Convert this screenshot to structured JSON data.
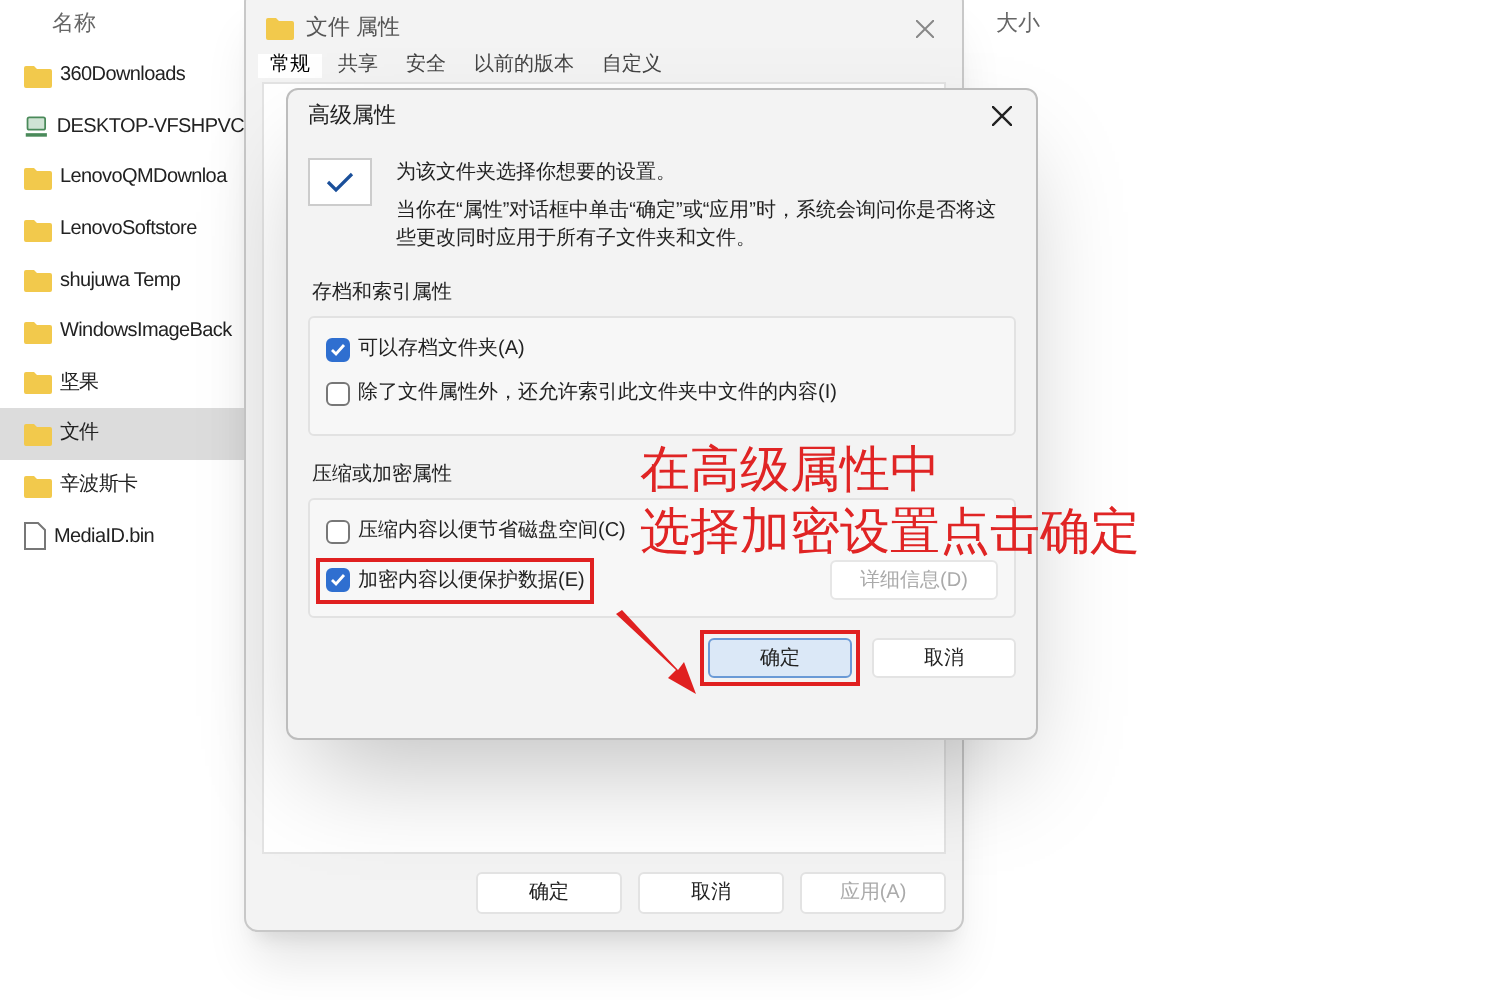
{
  "explorer": {
    "columns": [
      {
        "label": "名称"
      },
      {
        "label": "大小"
      }
    ],
    "items": [
      {
        "name": "360Downloads",
        "kind": "folder",
        "selected": false
      },
      {
        "name": "DESKTOP-VFSHPVC",
        "kind": "computer",
        "selected": false
      },
      {
        "name": "LenovoQMDownloa",
        "kind": "folder",
        "selected": false
      },
      {
        "name": "LenovoSoftstore",
        "kind": "folder",
        "selected": false
      },
      {
        "name": "shujuwa Temp",
        "kind": "folder",
        "selected": false
      },
      {
        "name": "WindowsImageBack",
        "kind": "folder",
        "selected": false
      },
      {
        "name": "坚果",
        "kind": "folder",
        "selected": false
      },
      {
        "name": "文件",
        "kind": "folder",
        "selected": true
      },
      {
        "name": "辛波斯卡",
        "kind": "folder",
        "selected": false
      },
      {
        "name": "MediaID.bin",
        "kind": "file",
        "selected": false
      }
    ]
  },
  "properties_window": {
    "title": "文件 属性",
    "tabs": [
      {
        "label": "常规",
        "selected": true
      },
      {
        "label": "共享",
        "selected": false
      },
      {
        "label": "安全",
        "selected": false
      },
      {
        "label": "以前的版本",
        "selected": false
      },
      {
        "label": "自定义",
        "selected": false
      }
    ],
    "buttons": [
      {
        "label": "确定",
        "disabled": false
      },
      {
        "label": "取消",
        "disabled": false
      },
      {
        "label": "应用(A)",
        "disabled": true
      }
    ]
  },
  "advanced_dialog": {
    "title": "高级属性",
    "intro": "为该文件夹选择你想要的设置。",
    "description": "当你在“属性”对话框中单击“确定”或“应用”时，系统会询问你是否将这些更改同时应用于所有子文件夹和文件。",
    "groups": [
      {
        "title": "存档和索引属性",
        "options": [
          {
            "label": "可以存档文件夹(A)",
            "checked": true,
            "annotated": false
          },
          {
            "label": "除了文件属性外，还允许索引此文件夹中文件的内容(I)",
            "checked": false,
            "annotated": false
          }
        ]
      },
      {
        "title": "压缩或加密属性",
        "options": [
          {
            "label": "压缩内容以便节省磁盘空间(C)",
            "checked": false,
            "annotated": false
          },
          {
            "label": "加密内容以便保护数据(E)",
            "checked": true,
            "annotated": true
          }
        ],
        "details_button": {
          "label": "详细信息(D)",
          "disabled": true
        }
      }
    ],
    "buttons": [
      {
        "label": "确定",
        "default": true,
        "annotated": true
      },
      {
        "label": "取消",
        "default": false,
        "annotated": false
      }
    ]
  },
  "annotation": {
    "lines": [
      "在高级属性中",
      "选择加密设置点击确定"
    ]
  }
}
